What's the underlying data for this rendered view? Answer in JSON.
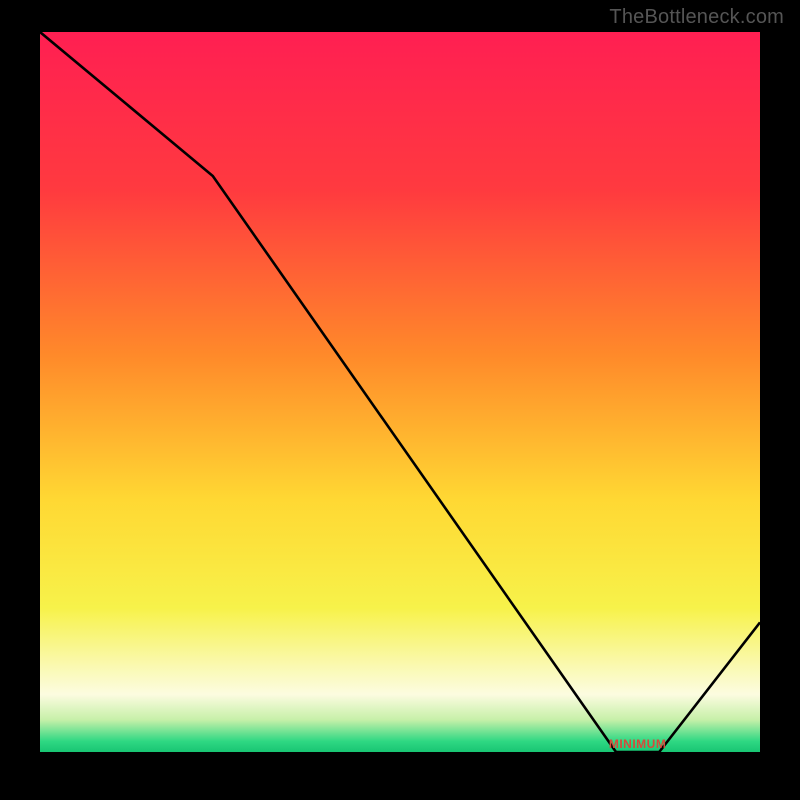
{
  "watermark": "TheBottleneck.com",
  "chart_data": {
    "type": "line",
    "title": "",
    "xlabel": "",
    "ylabel": "",
    "xlim": [
      0,
      100
    ],
    "ylim": [
      0,
      100
    ],
    "x": [
      0,
      24,
      80,
      86,
      100
    ],
    "values": [
      100,
      80,
      0,
      0,
      18
    ],
    "minimum_label": "MINIMUM",
    "minimum_x": 83,
    "gradient_stops": [
      {
        "offset": 0.0,
        "color": "#ff1f52"
      },
      {
        "offset": 0.22,
        "color": "#ff3a3f"
      },
      {
        "offset": 0.45,
        "color": "#ff8a2a"
      },
      {
        "offset": 0.65,
        "color": "#ffd833"
      },
      {
        "offset": 0.8,
        "color": "#f7f24a"
      },
      {
        "offset": 0.88,
        "color": "#faf9b0"
      },
      {
        "offset": 0.92,
        "color": "#fcfce0"
      },
      {
        "offset": 0.955,
        "color": "#c7f0a9"
      },
      {
        "offset": 0.985,
        "color": "#2fd883"
      },
      {
        "offset": 1.0,
        "color": "#18c573"
      }
    ],
    "line_color": "#000000",
    "line_width": 2.6
  }
}
